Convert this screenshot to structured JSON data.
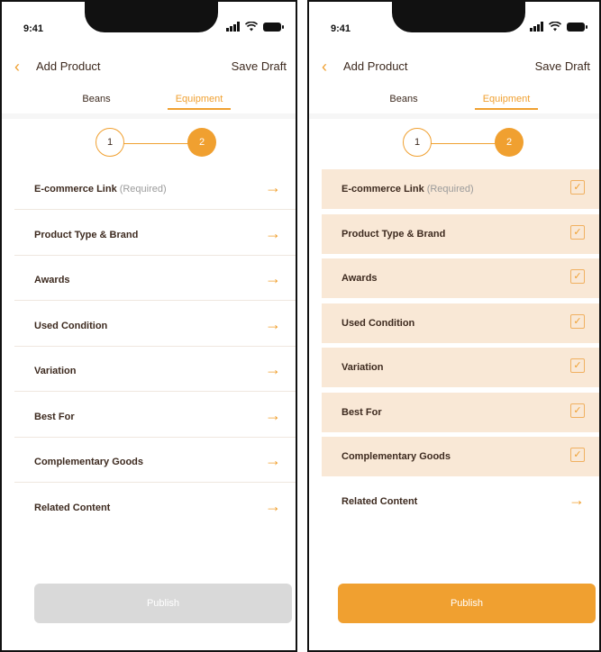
{
  "status": {
    "time": "9:41"
  },
  "nav": {
    "back": "‹",
    "title": "Add Product",
    "draft": "Save Draft"
  },
  "tabs": {
    "beans": "Beans",
    "equipment": "Equipment"
  },
  "stepper": {
    "step1": "1",
    "step2": "2"
  },
  "items": [
    {
      "label": "E-commerce Link",
      "note": "(Required)"
    },
    {
      "label": "Product Type & Brand"
    },
    {
      "label": "Awards"
    },
    {
      "label": "Used Condition"
    },
    {
      "label": "Variation"
    },
    {
      "label": "Best For"
    },
    {
      "label": "Complementary Goods"
    },
    {
      "label": "Related Content"
    }
  ],
  "icons": {
    "arrow": "→",
    "check": "✓"
  },
  "publish": {
    "label": "Publish"
  },
  "colors": {
    "accent": "#f0a030",
    "completed_row": "#f9e8d6",
    "disabled_button": "#d9d9d9"
  }
}
